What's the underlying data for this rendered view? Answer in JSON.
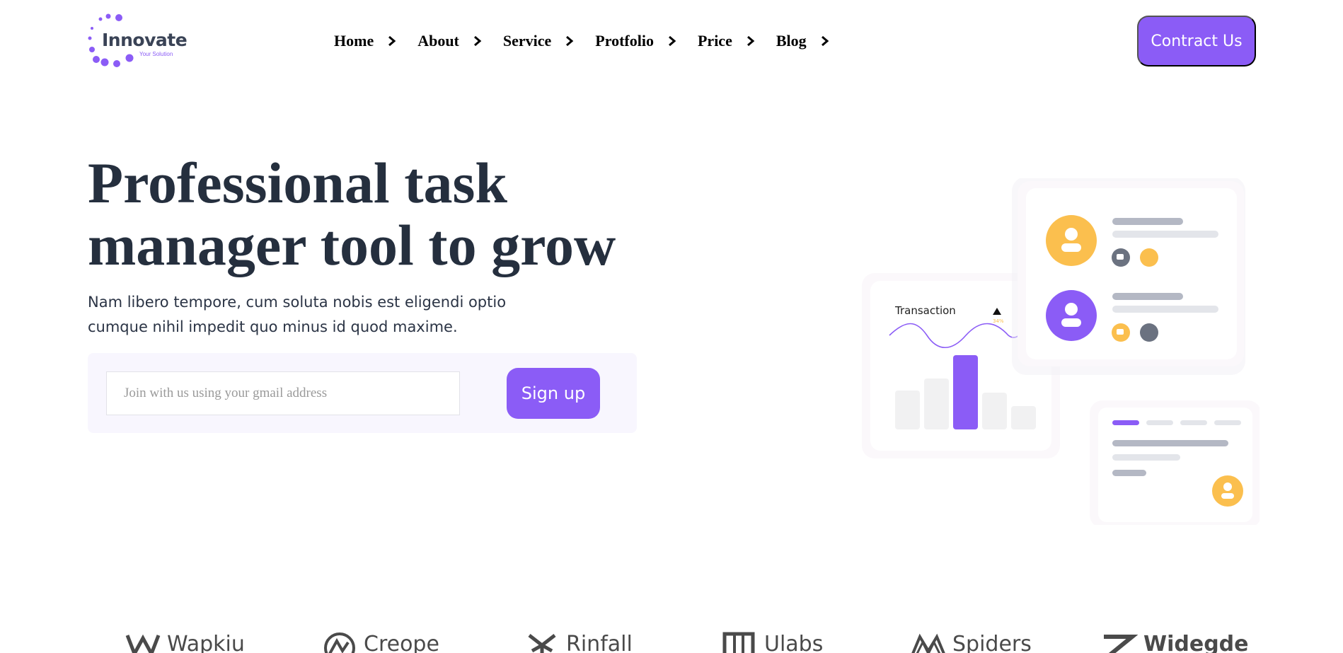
{
  "brand": {
    "name": "Innovate",
    "tagline": "Your Solution",
    "accent": "#8b5cf6"
  },
  "nav": {
    "items": [
      {
        "label": "Home"
      },
      {
        "label": "About"
      },
      {
        "label": "Service"
      },
      {
        "label": "Protfolio"
      },
      {
        "label": "Price"
      },
      {
        "label": "Blog"
      }
    ]
  },
  "header": {
    "contact_label": "Contract Us"
  },
  "hero": {
    "title_line1": "Professional task",
    "title_line2": "manager tool to grow",
    "subtitle_line1": "Nam libero tempore, cum soluta nobis est eligendi optio",
    "subtitle_line2": "cumque nihil impedit quo minus id quod maxime.",
    "email_placeholder": "Join with us using your gmail address",
    "email_value": "",
    "signup_label": "Sign up"
  },
  "illustration": {
    "card_title": "Transaction",
    "card_change": "34%"
  },
  "partners": [
    {
      "name": "Wapkiu"
    },
    {
      "name": "Creope"
    },
    {
      "name": "Rinfall"
    },
    {
      "name": "Ulabs"
    },
    {
      "name": "Spiders"
    },
    {
      "name": "Widegde"
    }
  ],
  "colors": {
    "primary": "#8b5cf6",
    "heading": "#252f3e",
    "yellow": "#fbbf4e",
    "box_bg": "#f8f6fe"
  }
}
